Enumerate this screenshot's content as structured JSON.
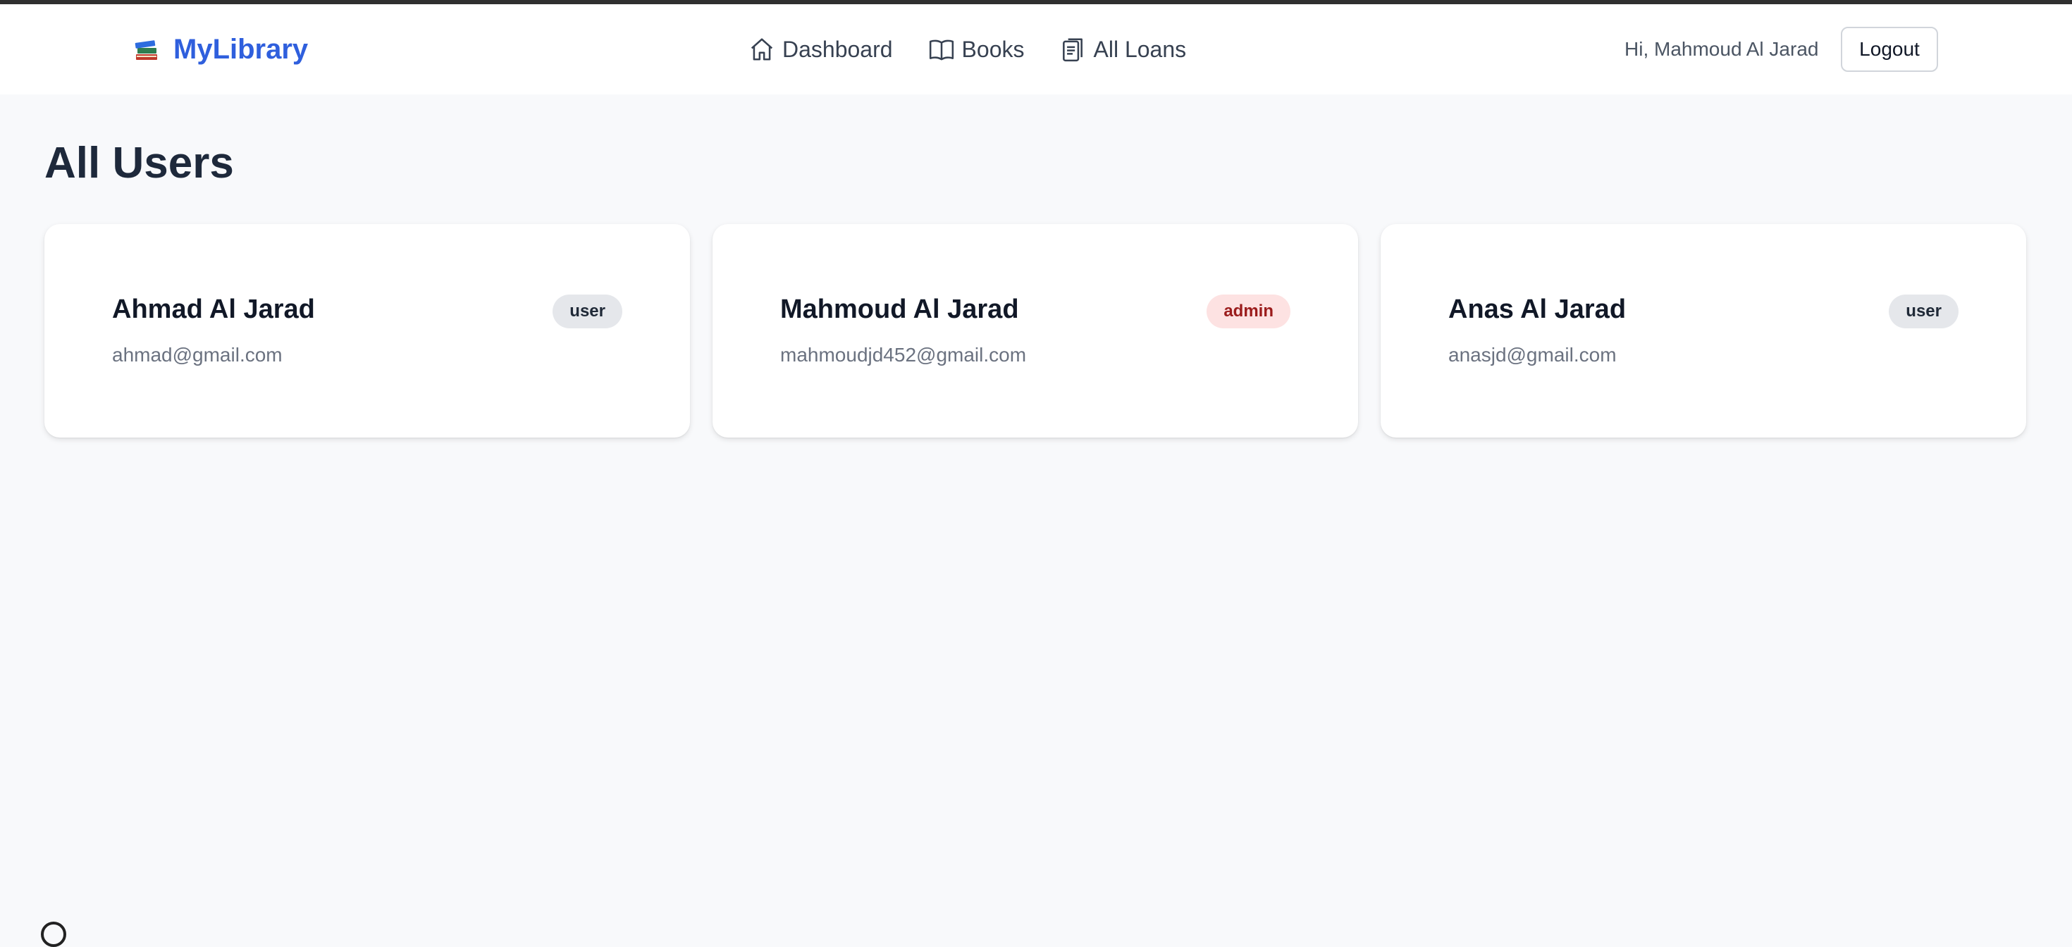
{
  "brand": {
    "name": "MyLibrary",
    "icon": "books-stack-icon"
  },
  "nav": {
    "dashboard": "Dashboard",
    "books": "Books",
    "all_loans": "All Loans"
  },
  "header": {
    "greeting": "Hi, Mahmoud Al Jarad",
    "logout_label": "Logout"
  },
  "page": {
    "title": "All Users"
  },
  "users": [
    {
      "name": "Ahmad Al Jarad",
      "email": "ahmad@gmail.com",
      "role": "user"
    },
    {
      "name": "Mahmoud Al Jarad",
      "email": "mahmoudjd452@gmail.com",
      "role": "admin"
    },
    {
      "name": "Anas Al Jarad",
      "email": "anasjd@gmail.com",
      "role": "user"
    }
  ],
  "colors": {
    "brand": "#2f5fdd",
    "admin_badge_bg": "#fde2e2",
    "admin_badge_text": "#9b1c1c",
    "user_badge_bg": "#e5e7eb"
  }
}
